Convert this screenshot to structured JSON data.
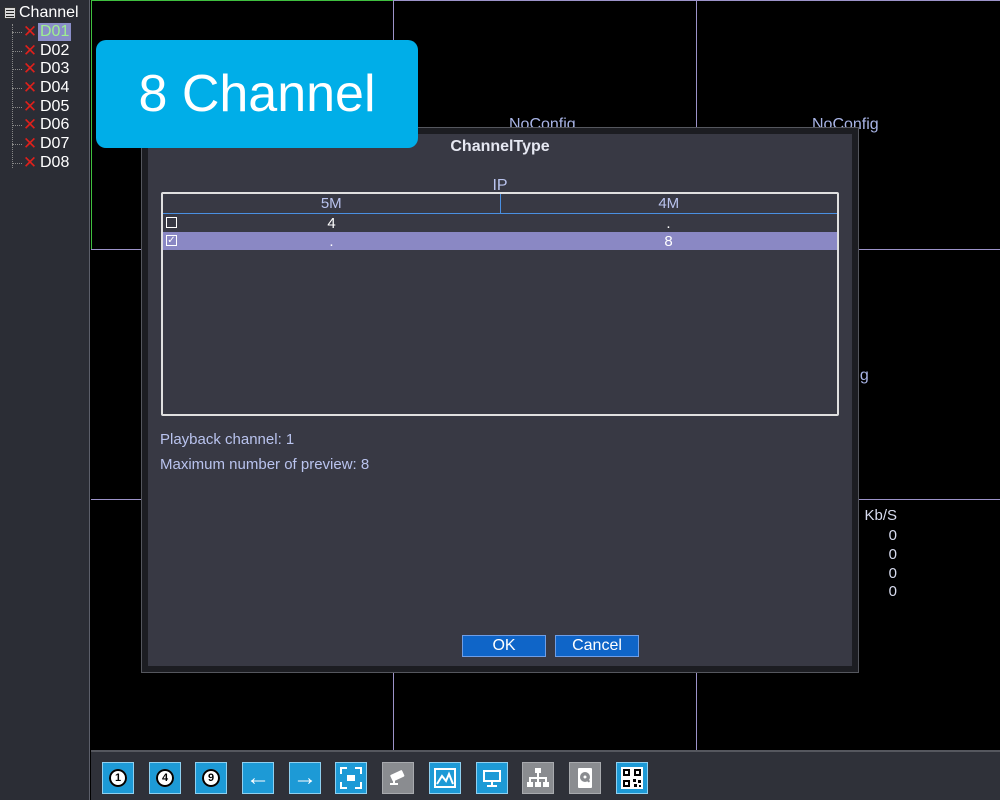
{
  "sidebar": {
    "title": "Channel",
    "channels": [
      {
        "label": "D01",
        "selected": true
      },
      {
        "label": "D02"
      },
      {
        "label": "D03"
      },
      {
        "label": "D04"
      },
      {
        "label": "D05"
      },
      {
        "label": "D06"
      },
      {
        "label": "D07"
      },
      {
        "label": "D08"
      }
    ]
  },
  "grid": {
    "cell_label_1": "NoConfig",
    "cell_label_2": "NoConfig",
    "cell_label_3": "nfig",
    "kbs_header": "Kb/S",
    "kbs_values": [
      "0",
      "0",
      "0",
      "0"
    ]
  },
  "badge": {
    "text": "8 Channel"
  },
  "dialog": {
    "title": "ChannelType",
    "group": "IP",
    "columns": [
      "5M",
      "4M"
    ],
    "rows": [
      {
        "checked": false,
        "c1": "4",
        "c2": "."
      },
      {
        "checked": true,
        "c1": ".",
        "c2": "8"
      }
    ],
    "playback": "Playback channel: 1",
    "max_preview": "Maximum number of preview: 8",
    "ok_label": "OK",
    "cancel_label": "Cancel",
    "check_mark": "✓"
  },
  "toolbar": {
    "buttons": [
      {
        "name": "single-view",
        "text": "1"
      },
      {
        "name": "quad-view",
        "text": "4"
      },
      {
        "name": "nine-view",
        "text": "9"
      }
    ],
    "arrow_left": "←",
    "arrow_right": "→"
  },
  "colors": {
    "accent": "#00aee8",
    "button": "#0f65c8",
    "selection": "#8a88c4",
    "grid_line": "#9c93c9",
    "error": "#e0201b"
  }
}
